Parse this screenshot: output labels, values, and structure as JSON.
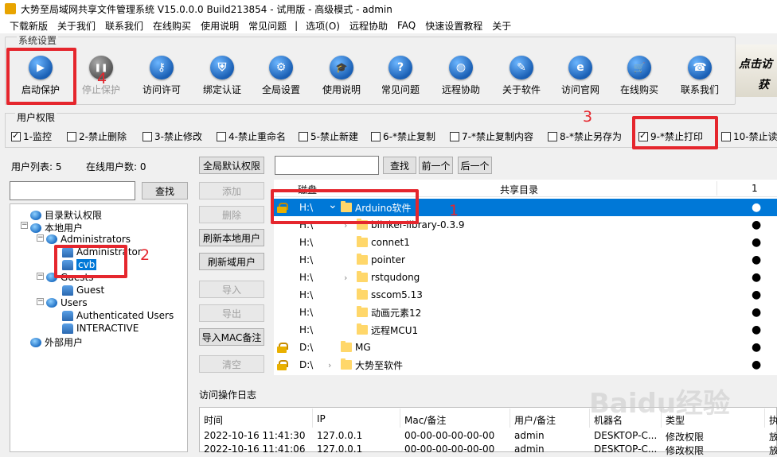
{
  "window": {
    "title": "大势至局域网共享文件管理系统 V15.0.0.0 Build213854 - 试用版 - 高级模式 - admin"
  },
  "menu": [
    "下载新版",
    "关于我们",
    "联系我们",
    "在线购买",
    "使用说明",
    "常见问题",
    "|",
    "选项(O)",
    "远程协助",
    "FAQ",
    "快速设置教程",
    "关于"
  ],
  "toolbar": {
    "group_label": "系统设置",
    "buttons": [
      {
        "label": "启动保护",
        "icon": "play-icon",
        "enabled": true
      },
      {
        "label": "停止保护",
        "icon": "pause-icon",
        "enabled": false
      },
      {
        "label": "访问许可",
        "icon": "key-icon",
        "enabled": true
      },
      {
        "label": "绑定认证",
        "icon": "shield-icon",
        "enabled": true
      },
      {
        "label": "全局设置",
        "icon": "gear-icon",
        "enabled": true
      },
      {
        "label": "使用说明",
        "icon": "graduation-cap-icon",
        "enabled": true
      },
      {
        "label": "常见问题",
        "icon": "question-icon",
        "enabled": true
      },
      {
        "label": "远程协助",
        "icon": "globe-icon",
        "enabled": true
      },
      {
        "label": "关于软件",
        "icon": "edit-icon",
        "enabled": true
      },
      {
        "label": "访问官网",
        "icon": "ie-icon",
        "enabled": true
      },
      {
        "label": "在线购买",
        "icon": "cart-icon",
        "enabled": true
      },
      {
        "label": "联系我们",
        "icon": "phone-icon",
        "enabled": true
      }
    ],
    "logo_line1": "点击访",
    "logo_line2": "获"
  },
  "permissions": {
    "group_label": "用户权限",
    "items": [
      {
        "label": "1-监控",
        "checked": true
      },
      {
        "label": "2-禁止删除",
        "checked": false
      },
      {
        "label": "3-禁止修改",
        "checked": false
      },
      {
        "label": "4-禁止重命名",
        "checked": false
      },
      {
        "label": "5-禁止新建",
        "checked": false
      },
      {
        "label": "6-*禁止复制",
        "checked": false
      },
      {
        "label": "7-*禁止复制内容",
        "checked": false
      },
      {
        "label": "8-*禁止另存为",
        "checked": false
      },
      {
        "label": "9-*禁止打印",
        "checked": true
      },
      {
        "label": "10-禁止读",
        "checked": false
      }
    ]
  },
  "users": {
    "list_label": "用户列表: 5",
    "online_label": "在线用户数: 0",
    "search_button": "查找",
    "search_value": ""
  },
  "tree": [
    {
      "label": "目录默认权限",
      "icon": "globe-icon"
    },
    {
      "label": "本地用户",
      "icon": "globe-icon",
      "expander": "−"
    },
    {
      "label": "Administrators",
      "icon": "globe-icon",
      "expander": "−"
    },
    {
      "label": "Administrator",
      "icon": "user-icon"
    },
    {
      "label": "cvb",
      "icon": "user-icon",
      "selected": true
    },
    {
      "label": "Guests",
      "icon": "globe-icon",
      "expander": "−"
    },
    {
      "label": "Guest",
      "icon": "user-icon"
    },
    {
      "label": "Users",
      "icon": "globe-icon",
      "expander": "−"
    },
    {
      "label": "Authenticated Users",
      "icon": "user-icon"
    },
    {
      "label": "INTERACTIVE",
      "icon": "user-icon"
    },
    {
      "label": "外部用户",
      "icon": "globe-icon"
    }
  ],
  "side_buttons": [
    {
      "label": "全局默认权限",
      "enabled": true
    },
    {
      "label": "添加",
      "enabled": false
    },
    {
      "label": "删除",
      "enabled": false
    },
    {
      "label": "刷新本地用户",
      "enabled": true
    },
    {
      "label": "刷新域用户",
      "enabled": true
    },
    {
      "label": "导入",
      "enabled": false
    },
    {
      "label": "导出",
      "enabled": false
    },
    {
      "label": "导入MAC备注",
      "enabled": true
    },
    {
      "label": "清空",
      "enabled": false
    }
  ],
  "dir_search": {
    "value": "",
    "find": "查找",
    "prev": "前一个",
    "next": "后一个"
  },
  "dir_columns": [
    "磁盘",
    "共享目录",
    "1"
  ],
  "dirs": [
    {
      "drive": "H:\\",
      "name": "Arduino软件",
      "lock": true,
      "chev": "⌄",
      "level": 0,
      "dot": "●",
      "selected": true
    },
    {
      "drive": "H:\\",
      "name": "blinker-library-0.3.9",
      "lock": false,
      "chev": "›",
      "level": 1,
      "dot": "●"
    },
    {
      "drive": "H:\\",
      "name": "connet1",
      "lock": false,
      "chev": "",
      "level": 1,
      "dot": "●"
    },
    {
      "drive": "H:\\",
      "name": "pointer",
      "lock": false,
      "chev": "",
      "level": 1,
      "dot": "●"
    },
    {
      "drive": "H:\\",
      "name": "rstqudong",
      "lock": false,
      "chev": "›",
      "level": 1,
      "dot": "●"
    },
    {
      "drive": "H:\\",
      "name": "sscom5.13",
      "lock": false,
      "chev": "",
      "level": 1,
      "dot": "●"
    },
    {
      "drive": "H:\\",
      "name": "动画元素12",
      "lock": false,
      "chev": "",
      "level": 1,
      "dot": "●"
    },
    {
      "drive": "H:\\",
      "name": "远程MCU1",
      "lock": false,
      "chev": "",
      "level": 1,
      "dot": "●"
    },
    {
      "drive": "D:\\",
      "name": "MG",
      "lock": true,
      "chev": "",
      "level": 0,
      "dot": "●"
    },
    {
      "drive": "D:\\",
      "name": "大势至软件",
      "lock": true,
      "chev": "›",
      "level": 0,
      "dot": "●"
    }
  ],
  "log": {
    "title": "访问操作日志",
    "columns": [
      "时间",
      "IP",
      "Mac/备注",
      "用户/备注",
      "机器名",
      "类型",
      "执"
    ],
    "rows": [
      [
        "2022-10-16 11:41:30",
        "127.0.0.1",
        "00-00-00-00-00-00",
        "admin",
        "DESKTOP-C...",
        "修改权限",
        "放"
      ],
      [
        "2022-10-16 11:41:06",
        "127.0.0.1",
        "00-00-00-00-00-00",
        "admin",
        "DESKTOP-C...",
        "修改权限",
        "放"
      ]
    ]
  },
  "annotations": [
    "4",
    "3",
    "1",
    "2"
  ],
  "watermark": "Baidu经验",
  "colors": {
    "highlight": "#e5262d",
    "selection": "#0078d7"
  }
}
